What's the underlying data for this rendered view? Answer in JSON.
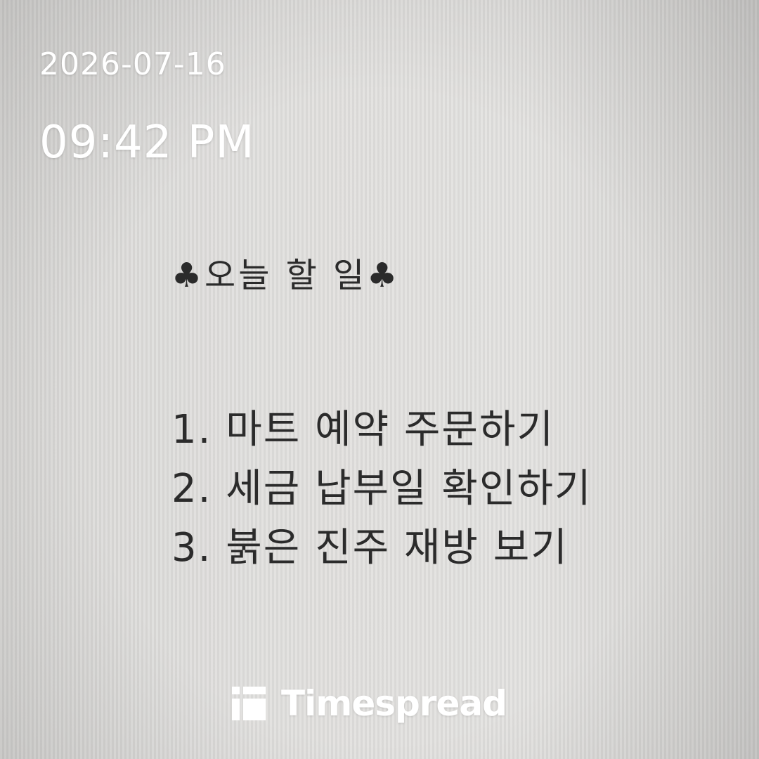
{
  "stamp": {
    "date": "2026-07-16",
    "time": "09:42 PM"
  },
  "note": {
    "title": "♣오늘 할 일♣",
    "items": [
      "1. 마트 예약 주문하기",
      "2. 세금 납부일 확인하기",
      "3. 붉은 진주 재방 보기"
    ]
  },
  "watermark": {
    "brand": "Timespread",
    "icon": "timespread-logo-icon",
    "color": "#ffffff"
  }
}
